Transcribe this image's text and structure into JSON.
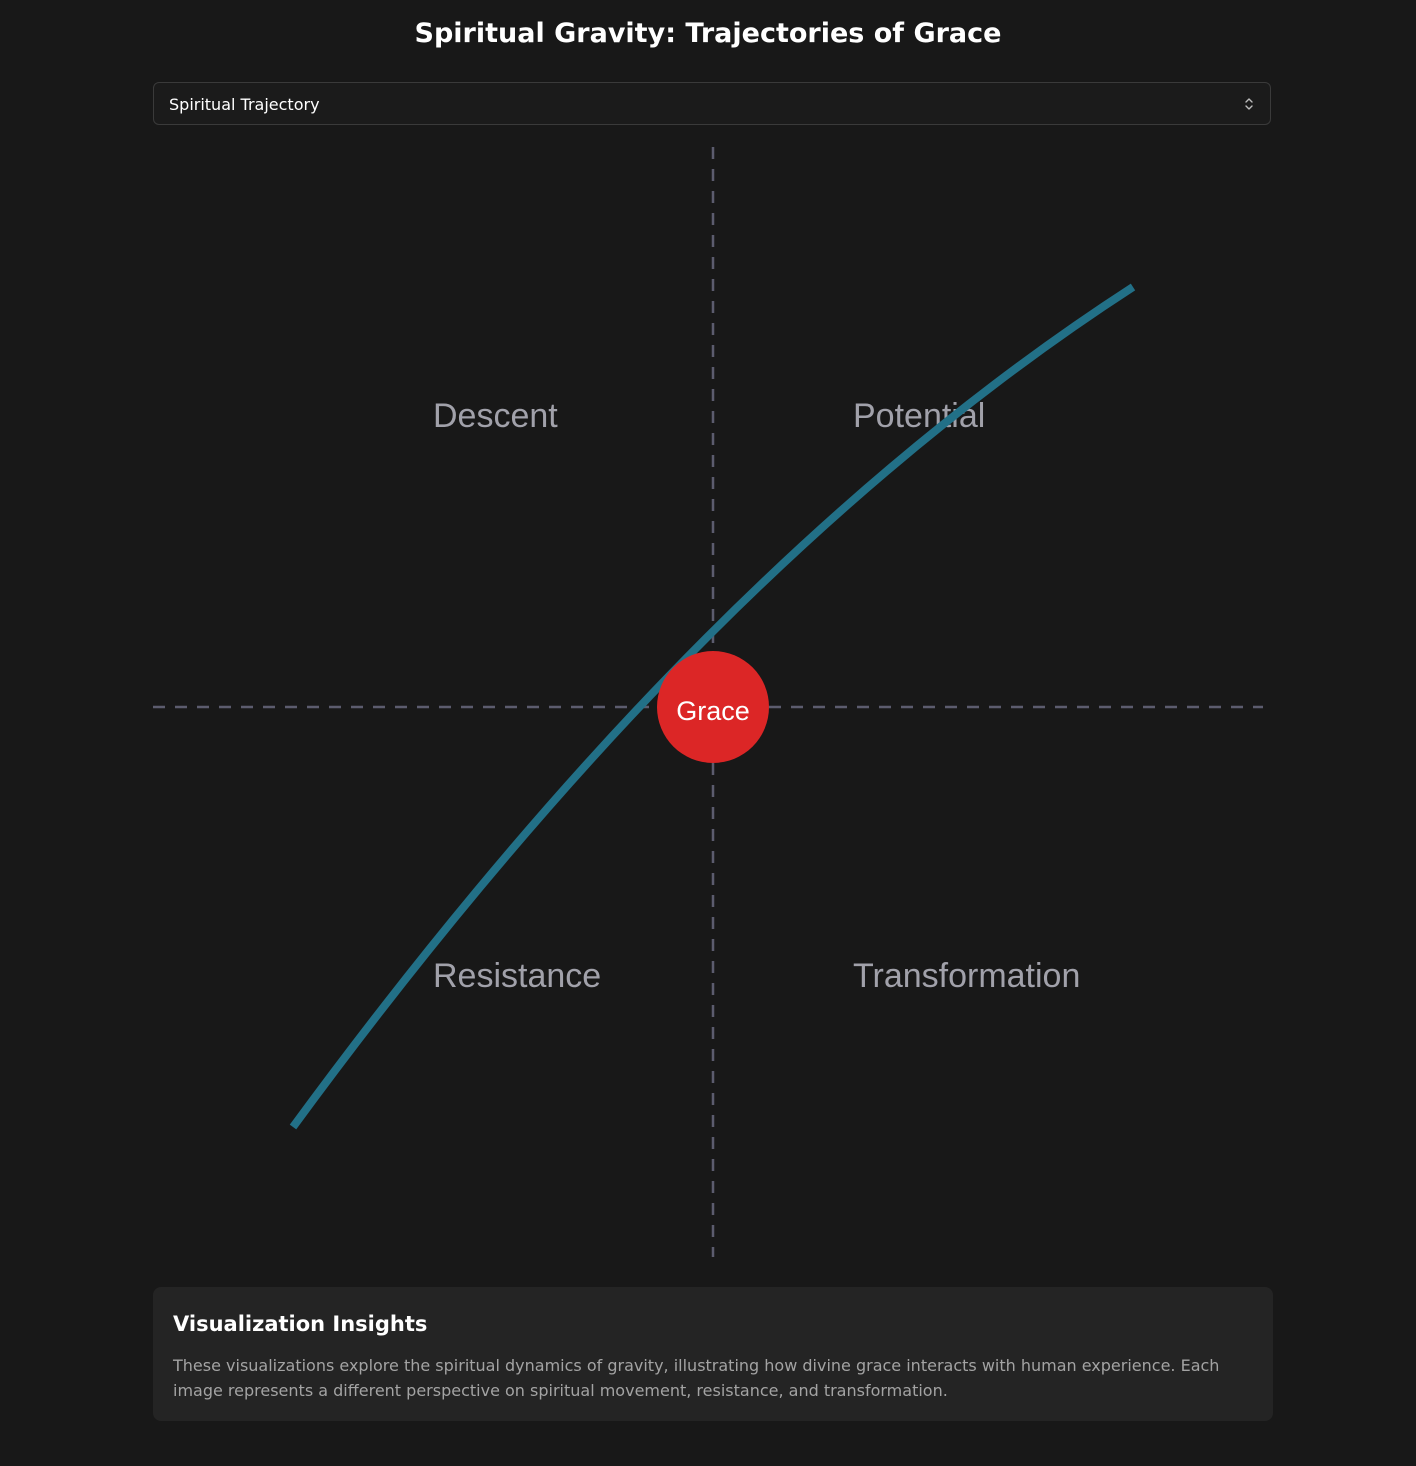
{
  "page": {
    "title": "Spiritual Gravity: Trajectories of Grace"
  },
  "selector": {
    "value": "Spiritual Trajectory",
    "icon": "chevron-up-down-icon"
  },
  "diagram": {
    "quadrants": {
      "top_left": "Descent",
      "top_right": "Potential",
      "bottom_left": "Resistance",
      "bottom_right": "Transformation"
    },
    "center_label": "Grace",
    "colors": {
      "trajectory": "#227087",
      "grace": "#dc2626",
      "axes": "#5c5c6e",
      "labels": "#a1a1aa"
    }
  },
  "insights": {
    "title": "Visualization Insights",
    "text": "These visualizations explore the spiritual dynamics of gravity, illustrating how divine grace interacts with human experience. Each image represents a different perspective on spiritual movement, resistance, and transformation."
  }
}
